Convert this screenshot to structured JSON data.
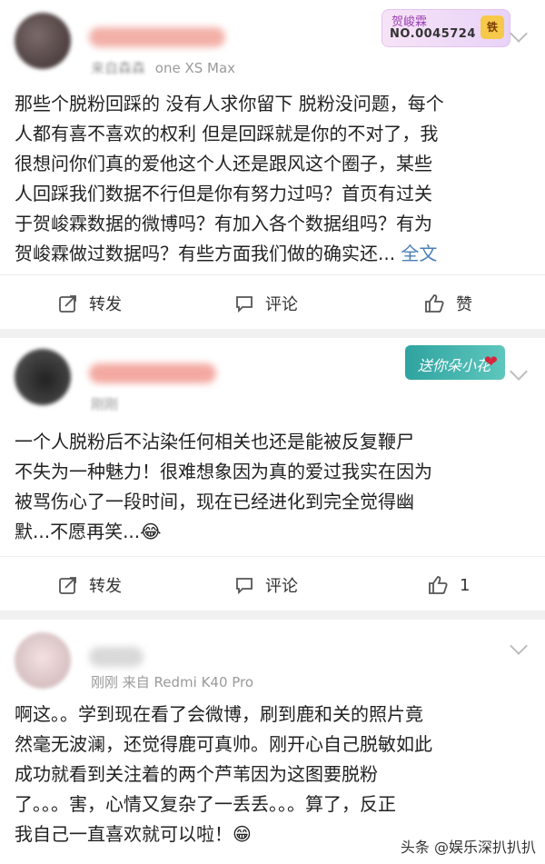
{
  "posts": [
    {
      "meta": "来自森森",
      "device": "one XS Max",
      "text": "那些个脱粉回踩的 没有人求你留下 脱粉没问题，每个\n人都有喜不喜欢的权利 但是回踩就是你的不对了，我\n很想问你们真的爱他这个人还是跟风这个圈子，某些\n人回踩我们数据不行但是你有努力过吗？首页有过关\n于贺峻霖数据的微博吗？有加入各个数据组吗？有为\n贺峻霖做过数据吗？有些方面我们做的确实还...",
      "more": " 全文",
      "badge": {
        "name": "贺峻霖",
        "number": "NO.0045724",
        "tag": "铁"
      },
      "actions": {
        "repost": "转发",
        "comment": "评论",
        "like": "赞"
      }
    },
    {
      "meta": "刚刚",
      "text": "一个人脱粉后不沾染任何相关也还是能被反复鞭尸\n不失为一种魅力！很难想象因为真的爱过我实在因为\n被骂伤心了一段时间，现在已经进化到完全觉得幽\n默...不愿再笑...",
      "emoji": "😂",
      "badge_text": "送你朵小花",
      "actions": {
        "repost": "转发",
        "comment": "评论",
        "like": "1"
      }
    },
    {
      "meta": "刚刚  来自 Redmi K40 Pro",
      "text": "啊这。。学到现在看了会微博，刷到鹿和关的照片竟\n然毫无波澜，还觉得鹿可真帅。刚开心自己脱敏如此\n成功就看到关注着的两个芦苇因为这图要脱粉\n了。。。害，心情又复杂了一丢丢。。。算了，反正\n我自己一直喜欢就可以啦！",
      "emoji": "😁"
    }
  ],
  "watermark": "头条 @娱乐深扒扒扒"
}
